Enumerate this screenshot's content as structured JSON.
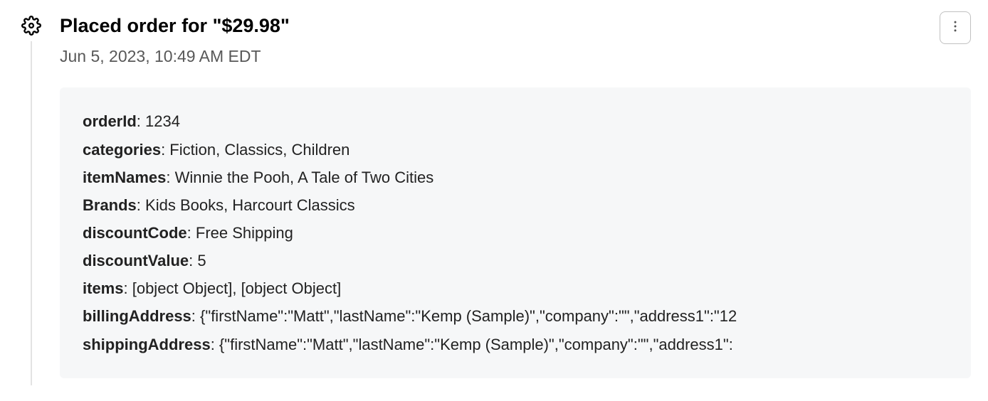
{
  "event": {
    "title": "Placed order for \"$29.98\"",
    "timestamp": "Jun 5, 2023, 10:49 AM EDT"
  },
  "details": {
    "rows": [
      {
        "key": "orderId",
        "value": "1234"
      },
      {
        "key": "categories",
        "value": "Fiction, Classics, Children"
      },
      {
        "key": "itemNames",
        "value": "Winnie the Pooh, A Tale of Two Cities"
      },
      {
        "key": "Brands",
        "value": "Kids Books, Harcourt Classics"
      },
      {
        "key": "discountCode",
        "value": "Free Shipping"
      },
      {
        "key": "discountValue",
        "value": "5"
      },
      {
        "key": "items",
        "value": "[object Object], [object Object]"
      },
      {
        "key": "billingAddress",
        "value": "{\"firstName\":\"Matt\",\"lastName\":\"Kemp (Sample)\",\"company\":\"\",\"address1\":\"12"
      },
      {
        "key": "shippingAddress",
        "value": "{\"firstName\":\"Matt\",\"lastName\":\"Kemp (Sample)\",\"company\":\"\",\"address1\":"
      }
    ]
  }
}
